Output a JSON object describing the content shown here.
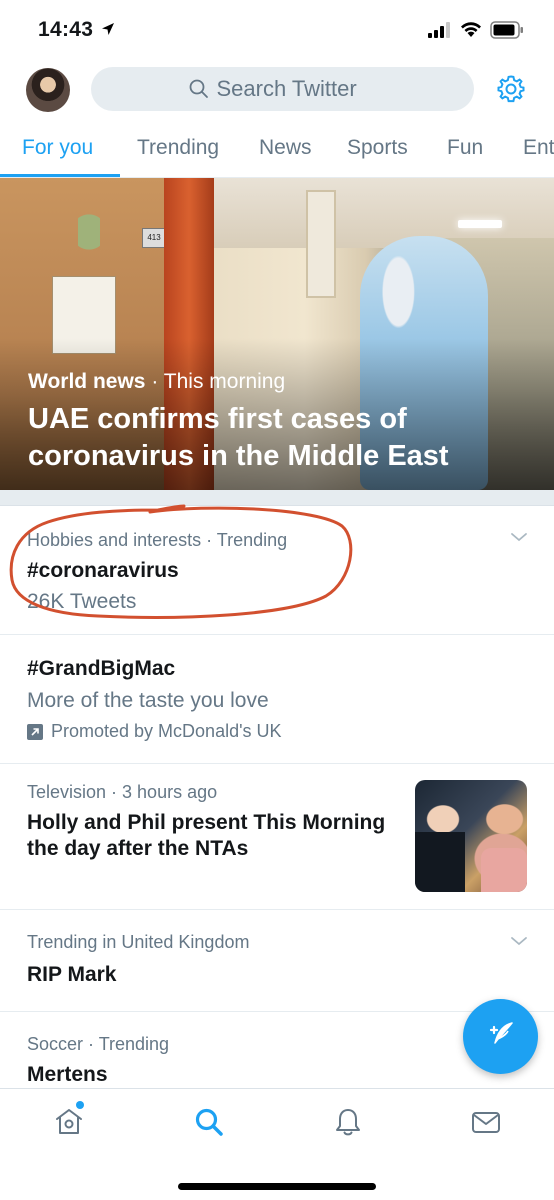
{
  "status_bar": {
    "time": "14:43"
  },
  "header": {
    "search_placeholder": "Search Twitter"
  },
  "tabs": [
    {
      "label": "For you",
      "active": true
    },
    {
      "label": "Trending"
    },
    {
      "label": "News"
    },
    {
      "label": "Sports"
    },
    {
      "label": "Fun"
    },
    {
      "label": "Ent"
    }
  ],
  "hero": {
    "category": "World news",
    "separator": "·",
    "time": "This morning",
    "headline": "UAE confirms first cases of coronavirus in the Middle East",
    "plaque_number": "413"
  },
  "trends": [
    {
      "meta": "Hobbies and interests · Trending",
      "title": "#coronaravirus",
      "count": "26K Tweets",
      "annotated": true,
      "annotation_color": "#d2502f"
    },
    {
      "title": "#GrandBigMac",
      "description": "More of the taste you love",
      "promoted": "Promoted by McDonald's UK"
    },
    {
      "meta": "Television · 3 hours ago",
      "title": "Holly and Phil present This Morning the day after the NTAs"
    },
    {
      "meta": "Trending in United Kingdom",
      "title": "RIP Mark"
    },
    {
      "meta": "Soccer · Trending",
      "title": "Mertens"
    }
  ],
  "icons": {
    "home": "home-icon",
    "explore": "search-icon",
    "notifications": "bell-icon",
    "messages": "mail-icon",
    "settings": "gear-icon",
    "compose": "compose-tweet-icon"
  },
  "colors": {
    "accent": "#1da1f2",
    "text_primary": "#14171a",
    "text_secondary": "#657786",
    "search_bg": "#e6ecf0"
  }
}
